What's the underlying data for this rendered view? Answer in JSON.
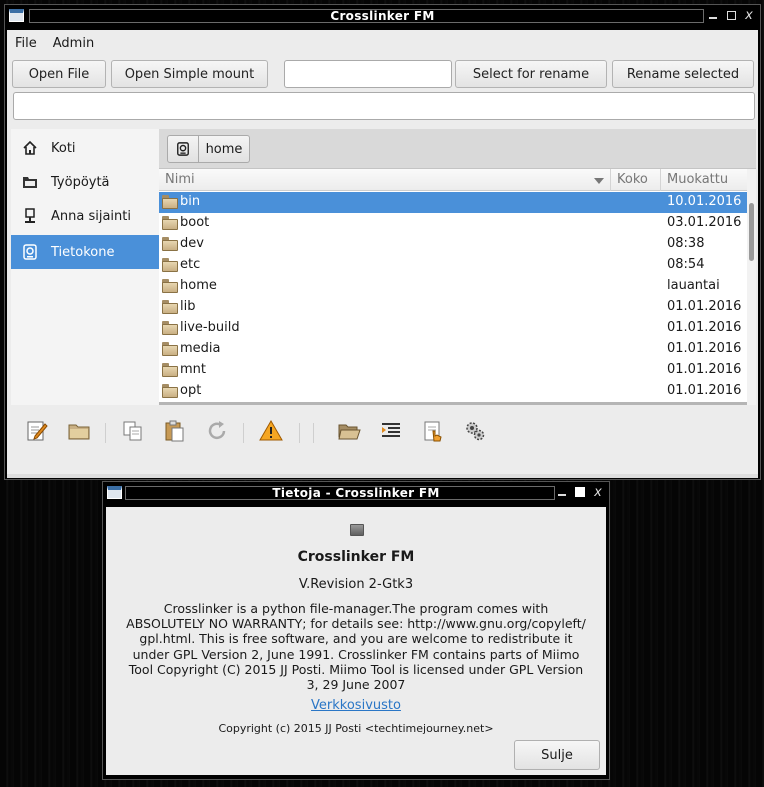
{
  "main_window": {
    "title": "Crosslinker FM",
    "menu": [
      "File",
      "Admin"
    ],
    "toolbar": {
      "open_file": "Open File",
      "open_simple_mount": "Open Simple mount",
      "rename_input_value": "",
      "select_for_rename": "Select for rename",
      "rename_selected": "Rename selected"
    },
    "location_input_value": "",
    "sidebar": [
      {
        "label": "Koti",
        "icon": "home-icon"
      },
      {
        "label": "Työpöytä",
        "icon": "desktop-folder-icon"
      },
      {
        "label": "Anna sijainti",
        "icon": "network-location-icon"
      },
      {
        "label": "Tietokone",
        "icon": "computer-icon",
        "active": true
      }
    ],
    "pathbar": {
      "current": "home"
    },
    "columns": [
      "Nimi",
      "Koko",
      "Muokattu"
    ],
    "files": [
      {
        "name": "bin",
        "modified": "10.01.2016",
        "selected": true
      },
      {
        "name": "boot",
        "modified": "03.01.2016"
      },
      {
        "name": "dev",
        "modified": "08:38"
      },
      {
        "name": "etc",
        "modified": "08:54"
      },
      {
        "name": "home",
        "modified": "lauantai"
      },
      {
        "name": "lib",
        "modified": "01.01.2016"
      },
      {
        "name": "live-build",
        "modified": "01.01.2016"
      },
      {
        "name": "media",
        "modified": "01.01.2016"
      },
      {
        "name": "mnt",
        "modified": "01.01.2016"
      },
      {
        "name": "opt",
        "modified": "01.01.2016"
      }
    ],
    "bottom_tools": [
      "edit-icon",
      "folder-icon",
      "copy-icon",
      "paste-icon",
      "refresh-icon",
      "warning-icon",
      "open-folder-icon",
      "indent-icon",
      "properties-icon",
      "settings-icon"
    ]
  },
  "about_dialog": {
    "title": "Tietoja - Crosslinker FM",
    "program_name": "Crosslinker FM",
    "version": "V.Revision 2-Gtk3",
    "comments": [
      "Crosslinker is a python file-manager.The program comes with",
      "ABSOLUTELY NO WARRANTY; for details see: http://www.gnu.org/copyleft/",
      "gpl.html. This is free software, and you are welcome to redistribute it",
      "under GPL Version 2, June 1991. Crosslinker FM contains parts of Miimo",
      "Tool Copyright (C) 2015 JJ Posti. Miimo Tool is licensed under GPL Version",
      "3, 29 June 2007"
    ],
    "website_label": "Verkkosivusto",
    "copyright": "Copyright (c) 2015 JJ Posti <techtimejourney.net>",
    "close_label": "Sulje"
  }
}
